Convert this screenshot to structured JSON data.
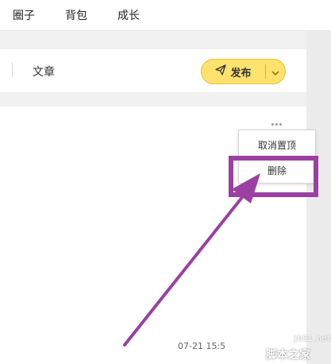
{
  "nav": {
    "items": [
      {
        "label": "圈子"
      },
      {
        "label": "背包"
      },
      {
        "label": "成长"
      }
    ]
  },
  "publisher": {
    "tab_article": "文章",
    "publish_label": "发布"
  },
  "menu": {
    "items": [
      {
        "label": "取消置顶"
      },
      {
        "label": "删除"
      }
    ]
  },
  "post": {
    "timestamp": "07-21 15:5"
  },
  "watermark": {
    "url": "jb51.net",
    "name": "脚本之家"
  },
  "colors": {
    "accent_yellow": "#fde36d",
    "annotation_purple": "#9b3fa2"
  }
}
